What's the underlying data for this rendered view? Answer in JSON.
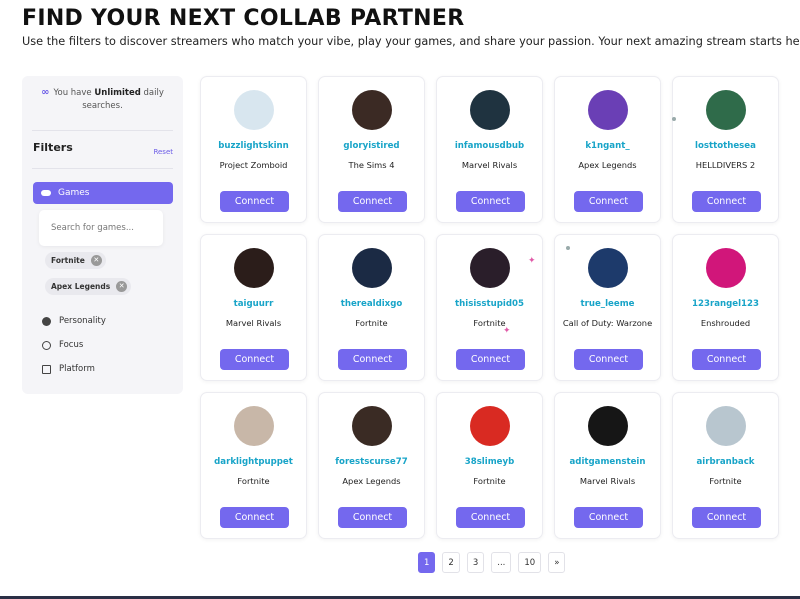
{
  "header": {
    "title": "FIND YOUR NEXT COLLAB PARTNER",
    "subtitle": "Use the filters to discover streamers who match your vibe, play your games, and share your passion. Your next amazing stream starts here."
  },
  "sidebar": {
    "limit_prefix": "You have ",
    "limit_bold": "Unlimited",
    "limit_suffix": " daily searches.",
    "infinity_glyph": "∞",
    "filters_title": "Filters",
    "reset_label": "Reset",
    "games_label": "Games",
    "search_placeholder": "Search for games...",
    "chips": [
      "Fortnite",
      "Apex Legends"
    ],
    "chip_remove_glyph": "✕",
    "items": [
      {
        "label": "Personality",
        "icon": "personality-icon"
      },
      {
        "label": "Focus",
        "icon": "focus-icon"
      },
      {
        "label": "Platform",
        "icon": "platform-icon"
      }
    ]
  },
  "connect_label": "Connect",
  "cards": [
    {
      "username": "buzzlightskinn",
      "game": "Project Zomboid",
      "avatar_color": "#d8e6ef"
    },
    {
      "username": "gloryistired",
      "game": "The Sims 4",
      "avatar_color": "#3b2a24"
    },
    {
      "username": "infamousdbub",
      "game": "Marvel Rivals",
      "avatar_color": "#1f3340"
    },
    {
      "username": "k1ngant_",
      "game": "Apex Legends",
      "avatar_color": "#6a3fb5"
    },
    {
      "username": "losttothesea",
      "game": "HELLDIVERS 2",
      "avatar_color": "#2f6b4a"
    },
    {
      "username": "taiguurr",
      "game": "Marvel Rivals",
      "avatar_color": "#2b1d1a"
    },
    {
      "username": "therealdixgo",
      "game": "Fortnite",
      "avatar_color": "#1b2a44"
    },
    {
      "username": "thisisstupid05",
      "game": "Fortnite",
      "avatar_color": "#2a1e2a"
    },
    {
      "username": "true_leeme",
      "game": "Call of Duty: Warzone",
      "avatar_color": "#1d3a6b"
    },
    {
      "username": "123rangel123",
      "game": "Enshrouded",
      "avatar_color": "#d1167a"
    },
    {
      "username": "darklightpuppet",
      "game": "Fortnite",
      "avatar_color": "#c8b7a8"
    },
    {
      "username": "forestscurse77",
      "game": "Apex Legends",
      "avatar_color": "#3a2b24"
    },
    {
      "username": "38slimeyb",
      "game": "Fortnite",
      "avatar_color": "#d92a22"
    },
    {
      "username": "aditgamenstein",
      "game": "Marvel Rivals",
      "avatar_color": "#161616"
    },
    {
      "username": "airbranback",
      "game": "Fortnite",
      "avatar_color": "#b8c6cf"
    }
  ],
  "pagination": {
    "pages": [
      "1",
      "2",
      "3",
      "...",
      "10",
      "»"
    ],
    "active": "1"
  }
}
